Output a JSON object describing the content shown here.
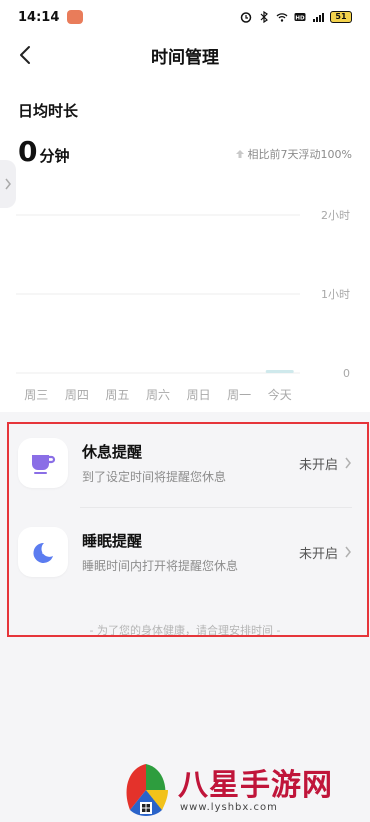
{
  "status": {
    "time": "14:14",
    "battery": "51"
  },
  "nav": {
    "title": "时间管理"
  },
  "summary": {
    "label": "日均时长",
    "value": "0",
    "unit": "分钟",
    "compare": "相比前7天浮动100%"
  },
  "chart_data": {
    "type": "bar",
    "categories": [
      "周三",
      "周四",
      "周五",
      "周六",
      "周日",
      "周一",
      "今天"
    ],
    "values": [
      0,
      0,
      0,
      0,
      0,
      0,
      0
    ],
    "ytick_labels": [
      "0",
      "1小时",
      "2小时"
    ],
    "ylim": [
      0,
      2
    ],
    "grid": true,
    "bar_color": "#cfe9ec"
  },
  "reminders": [
    {
      "title": "休息提醒",
      "desc": "到了设定时间将提醒您休息",
      "status": "未开启",
      "icon": "cup-icon",
      "icon_color": "#8a6ee6"
    },
    {
      "title": "睡眠提醒",
      "desc": "睡眠时间内打开将提醒您休息",
      "status": "未开启",
      "icon": "moon-icon",
      "icon_color": "#5b7cf0"
    }
  ],
  "footer_note": "- 为了您的身体健康，请合理安排时间 -",
  "watermark": {
    "text": "八星手游网",
    "url": "www.lyshbx.com"
  },
  "colors": {
    "highlight": "#e6353a",
    "accent_purple": "#8a6ee6",
    "accent_blue": "#5b7cf0"
  }
}
